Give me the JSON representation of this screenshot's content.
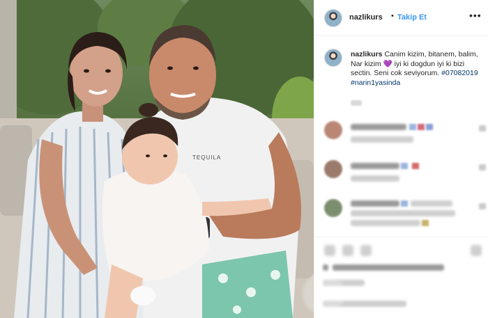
{
  "post": {
    "username": "nazlikurs",
    "separator": "•",
    "follow_label": "Takip Et",
    "more_icon": "more-horizontal-icon",
    "shirt_text": "TEQUILA"
  },
  "caption": {
    "username": "nazlikurs",
    "text_part1": "Canim kizim, bitanem, balim, Nar kizim",
    "heart_emoji": "💜",
    "text_part2": "iyi ki dogdun iyi ki bizi sectin. Seni cok seviyorum.",
    "hashtag1": "#07082019",
    "hashtag2": "#narin1yasinda"
  },
  "colors": {
    "link_blue": "#3897f0",
    "hashtag_blue": "#003569",
    "heart_purple": "#8e44cf",
    "text": "#262626"
  }
}
